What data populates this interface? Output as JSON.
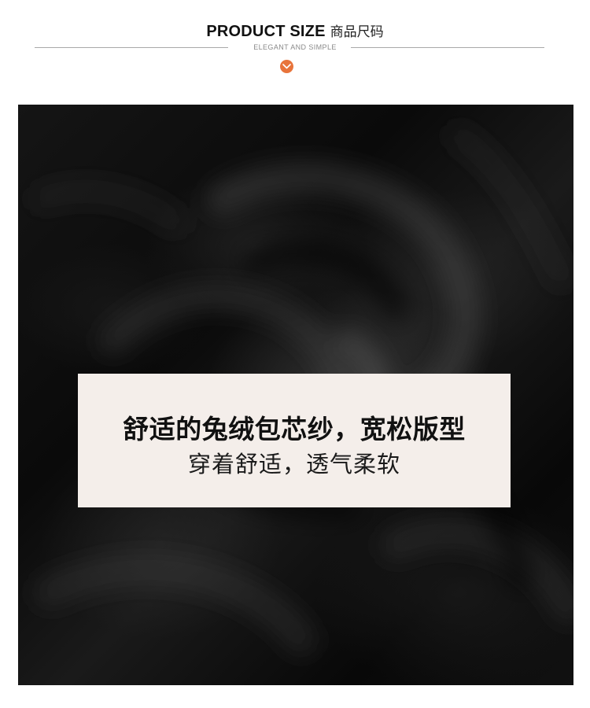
{
  "header": {
    "title_en": "PRODUCT SIZE",
    "title_cn": "商品尺码",
    "subtitle": "ELEGANT AND SIMPLE",
    "badge_icon": "chevron-down-icon",
    "accent_color": "#e8743b"
  },
  "fabric_image": {
    "description_color": "#0d0d0d"
  },
  "caption": {
    "main": "舒适的兔绒包芯纱，宽松版型",
    "sub": "穿着舒适，透气柔软",
    "box_color": "#f4eeea"
  }
}
